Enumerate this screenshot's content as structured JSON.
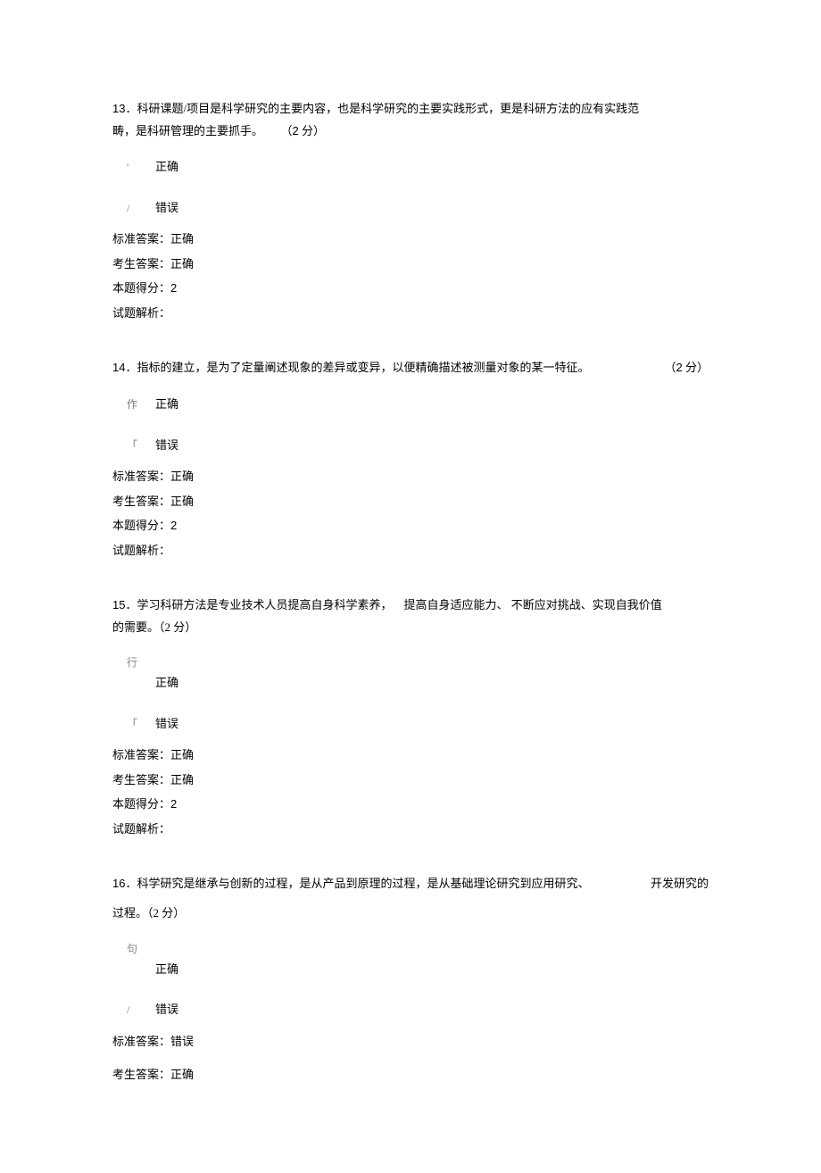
{
  "labels": {
    "standard_answer": "标准答案：",
    "student_answer": "考生答案：",
    "score_label": "本题得分：",
    "analysis_label": "试题解析：",
    "option_true": "正确",
    "option_false": "错误"
  },
  "questions": [
    {
      "num": "13",
      "text_line1": "．科研课题/项目是科学研究的主要内容，也是科学研究的主要实践形式，更是科研方法的应有实践范",
      "text_line2": "畴，是科研管理的主要抓手。",
      "points_prefix": "（",
      "points_num": "2",
      "points_suffix": " 分）",
      "opt_true_marker": "'",
      "opt_true_label": "正确",
      "opt_false_marker": "/",
      "opt_false_label": "错误",
      "standard": "正确",
      "student": "正确",
      "score": "2",
      "analysis": ""
    },
    {
      "num": "14",
      "text_line1": "．指标的建立，是为了定量阐述现象的差异或变异，以便精确描述被测量对象的某一特征。",
      "text_line2": "",
      "points_prefix": "（",
      "points_num": "2",
      "points_suffix": " 分）",
      "opt_true_marker": "作",
      "opt_true_label": "正确",
      "opt_false_marker": "「",
      "opt_false_label": "错误",
      "standard": "正确",
      "student": "正确",
      "score": "2",
      "analysis": ""
    },
    {
      "num": "15",
      "text_line1": "．学习科研方法是专业技术人员提高自身科学素养， 提高自身适应能力、 不断应对挑战、实现自我价值",
      "text_line2": "的需要。（2 分）",
      "points_prefix": "",
      "points_num": "",
      "points_suffix": "",
      "opt_true_marker": "行",
      "opt_true_label": "正确",
      "opt_false_marker": "「",
      "opt_false_label": "错误",
      "standard": "正确",
      "student": "正确",
      "score": "2",
      "analysis": ""
    },
    {
      "num": "16",
      "text_line1_a": "．科学研究是继承与创新的过程，是从产品到原理的过程，是从基础理论研究到应用研究、",
      "text_line1_b": "开发研究的",
      "text_line2": "过程。（2 分）",
      "points_prefix": "",
      "points_num": "",
      "points_suffix": "",
      "opt_true_marker": "句",
      "opt_true_label": "正确",
      "opt_false_marker": "/",
      "opt_false_label": "错误",
      "standard": "错误",
      "student": "正确",
      "score": "",
      "analysis": ""
    }
  ]
}
